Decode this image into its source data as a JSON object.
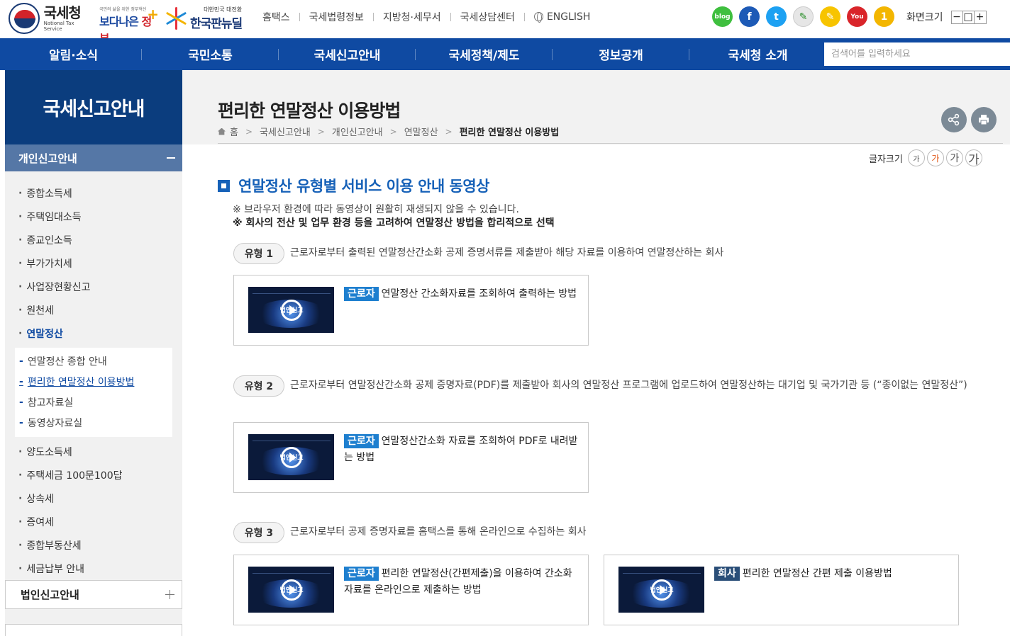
{
  "header": {
    "logo_nts_ko": "국세청",
    "logo_nts_en": "National Tax Service",
    "logo_better_small": "국민의 삶을 위한 정부혁신",
    "logo_better_a": "보다나은",
    "logo_better_b": "정부",
    "logo_newdeal_small": "대한민국 대전환",
    "logo_newdeal_big": "한국판뉴딜",
    "util_links": [
      "홈택스",
      "국세법령정보",
      "지방청·세무서",
      "국세상담센터",
      "ENGLISH"
    ],
    "sns": [
      {
        "name": "blog",
        "label": "blog",
        "color": "#3fbf3f"
      },
      {
        "name": "facebook",
        "label": "f",
        "color": "#1d5ab6"
      },
      {
        "name": "twitter",
        "label": "t",
        "color": "#1da1f2"
      },
      {
        "name": "pen",
        "label": "✎",
        "color": "#e6e6e6"
      },
      {
        "name": "kakao",
        "label": "✎",
        "color": "#f7c400"
      },
      {
        "name": "youtube",
        "label": "You",
        "color": "#d9252a"
      },
      {
        "name": "one",
        "label": "1",
        "color": "#f3b600"
      }
    ],
    "screen_size_label": "화면크기",
    "screen_size_btns": [
      "−",
      "□",
      "+"
    ]
  },
  "gnb": {
    "menu": [
      "알림·소식",
      "국민소통",
      "국세신고안내",
      "국세정책/제도",
      "정보공개",
      "국세청 소개"
    ],
    "search_placeholder": "검색어를 입력하세요"
  },
  "lnb": {
    "title": "국세신고안내",
    "group": "개인신고안내",
    "items_before": [
      "종합소득세",
      "주택임대소득",
      "종교인소득",
      "부가가치세",
      "사업장현황신고",
      "원천세"
    ],
    "active": "연말정산",
    "sub": [
      "연말정산 종합 안내",
      "편리한 연말정산 이용방법",
      "참고자료실",
      "동영상자료실"
    ],
    "items_after": [
      "양도소득세",
      "주택세금 100문100답",
      "상속세",
      "증여세",
      "종합부동산세",
      "세금납부 안내"
    ],
    "corp": "법인신고안내"
  },
  "page": {
    "title": "편리한 연말정산 이용방법",
    "breadcrumb": [
      "홈",
      "국세신고안내",
      "개인신고안내",
      "연말정산",
      "편리한 연말정산 이용방법"
    ],
    "font_size_label": "글자크기",
    "font_sizes": [
      "가",
      "가",
      "가",
      "가"
    ],
    "section_title": "연말정산 유형별 서비스 이용 안내 동영상",
    "note1": "※ 브라우저 환경에 따라 동영상이 원활히 재생되지 않을 수 있습니다.",
    "note2": "※ 회사의 전산 및 업무 환경 등을 고려하여 연말정산 방법을 합리적으로 선택"
  },
  "types": [
    {
      "badge": "유형 1",
      "desc": "근로자로부터 출력된 연말정산간소화 공제 증명서류를 제출받아 해당 자료를 이용하여 연말정산하는 회사",
      "videos": [
        {
          "tag": "근로자",
          "text": "연말정산 간소화자료를 조회하여 출력하는 방법",
          "thumb": "법인신고"
        }
      ]
    },
    {
      "badge": "유형 2",
      "desc": "근로자로부터 연말정산간소화 공제 증명자료(PDF)를 제출받아 회사의 연말정산 프로그램에 업로드하여 연말정산하는 대기업 및 국가기관 등 (“종이없는 연말정산”)",
      "videos": [
        {
          "tag": "근로자",
          "text": "연말정산간소화 자료를 조회하여 PDF로 내려받는 방법",
          "thumb": "법인신고"
        }
      ]
    },
    {
      "badge": "유형 3",
      "desc": "근로자로부터 공제 증명자료를 홈택스를 통해 온라인으로 수집하는 회사",
      "videos": [
        {
          "tag": "근로자",
          "text": "편리한 연말정산(간편제출)을 이용하여 간소화자료를 온라인으로 제출하는 방법",
          "thumb": "법인신고"
        },
        {
          "tag": "회사",
          "text": "편리한 연말정산 간편 제출 이용방법",
          "thumb": "법인신고"
        }
      ]
    }
  ]
}
